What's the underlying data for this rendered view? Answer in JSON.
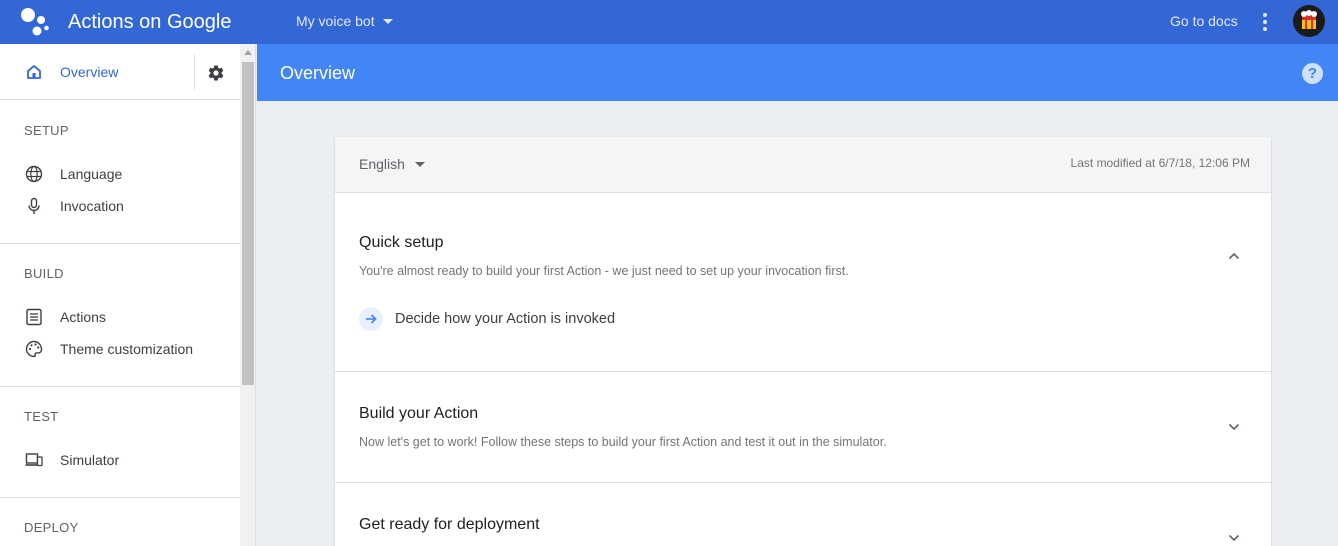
{
  "topbar": {
    "app_title": "Actions on Google",
    "project_name": "My voice bot",
    "docs_link": "Go to docs"
  },
  "sidebar": {
    "overview_label": "Overview",
    "sections": [
      {
        "heading": "SETUP",
        "items": [
          {
            "label": "Language",
            "icon": "globe-icon"
          },
          {
            "label": "Invocation",
            "icon": "microphone-icon"
          }
        ]
      },
      {
        "heading": "BUILD",
        "items": [
          {
            "label": "Actions",
            "icon": "list-icon"
          },
          {
            "label": "Theme customization",
            "icon": "palette-icon"
          }
        ]
      },
      {
        "heading": "TEST",
        "items": [
          {
            "label": "Simulator",
            "icon": "devices-icon"
          }
        ]
      },
      {
        "heading": "DEPLOY",
        "items": []
      }
    ]
  },
  "header": {
    "title": "Overview",
    "help": "?"
  },
  "card": {
    "language": "English",
    "last_modified": "Last modified at 6/7/18, 12:06 PM",
    "panels": [
      {
        "title": "Quick setup",
        "description": "You're almost ready to build your first Action - we just need to set up your invocation first.",
        "expanded": true,
        "steps": [
          "Decide how your Action is invoked"
        ]
      },
      {
        "title": "Build your Action",
        "description": "Now let's get to work! Follow these steps to build your first Action and test it out in the simulator.",
        "expanded": false
      },
      {
        "title": "Get ready for deployment",
        "expanded": false
      }
    ]
  },
  "colors": {
    "topbar": "#3367d6",
    "header": "#4285f4",
    "accent": "#3367d6",
    "background": "#eceff1"
  }
}
